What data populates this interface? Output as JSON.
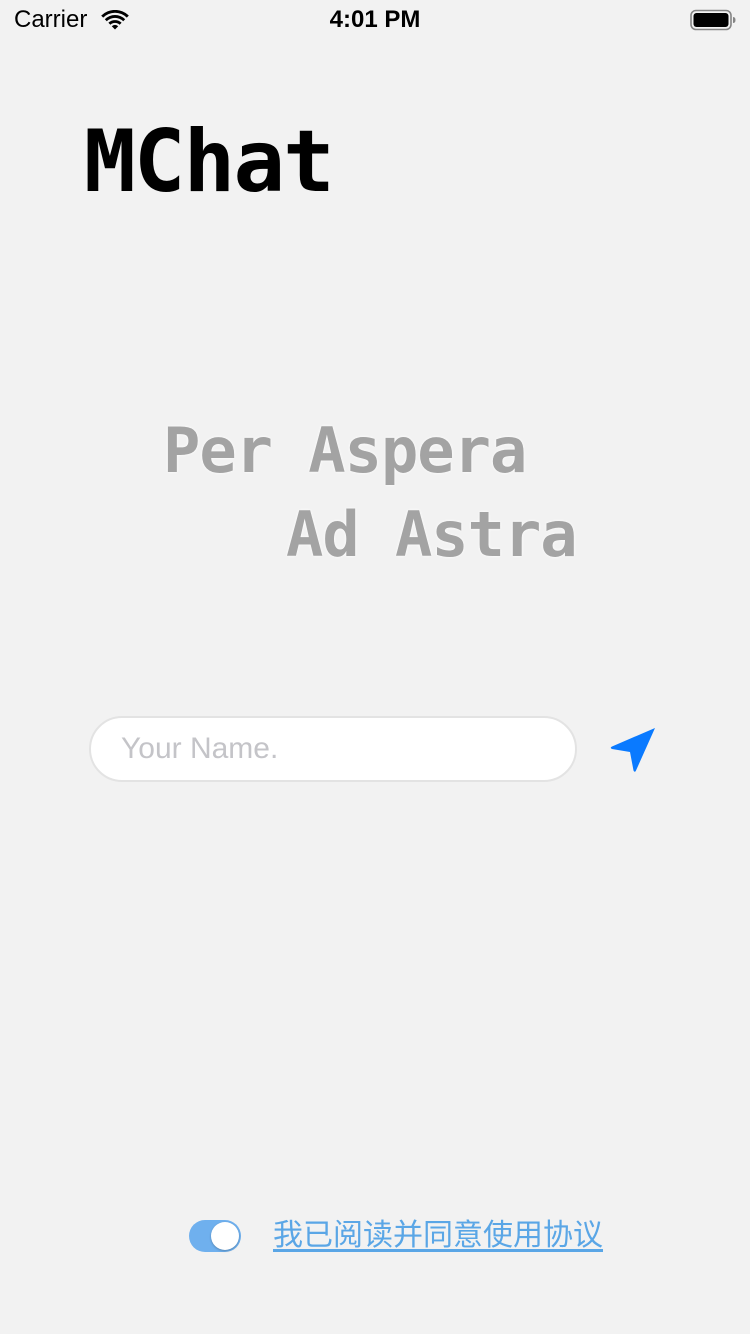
{
  "status_bar": {
    "carrier": "Carrier",
    "time": "4:01 PM",
    "wifi_icon": "wifi-icon",
    "battery_icon": "battery-full-icon"
  },
  "app": {
    "title": "MChat"
  },
  "motto": {
    "line1": "Per Aspera",
    "line2": "Ad Astra"
  },
  "login": {
    "name_placeholder": "Your Name.",
    "name_value": "",
    "send_icon": "send-icon"
  },
  "agreement": {
    "toggle_on": true,
    "link_text": "我已阅读并同意使用协议"
  },
  "colors": {
    "background": "#f2f2f2",
    "accent": "#0a7aff",
    "link": "#5aa6e6",
    "toggle_on": "#6fb0ee",
    "motto": "#a3a3a3"
  }
}
